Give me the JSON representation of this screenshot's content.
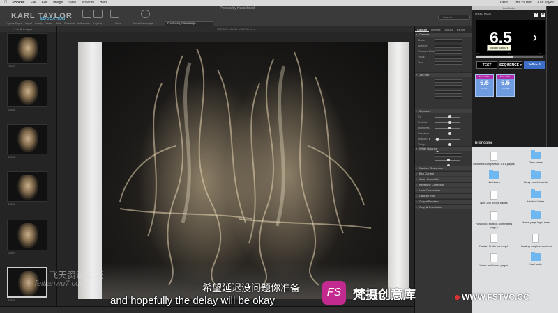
{
  "menubar": {
    "app": "Phocus",
    "items": [
      "File",
      "Edit",
      "Image",
      "View",
      "Window",
      "Help"
    ],
    "window_title": "Phocus by Hasselblad",
    "datetime": "Thu 15 Nov",
    "battery": "100%",
    "user": "Karl Taylor"
  },
  "toolbar": {
    "logo": "KARL TAYLOR",
    "logo_sub": "EDUCATION",
    "capture_style": "Capture (Standard)",
    "search_placeholder": "Search",
    "labels": [
      "Capture",
      "Export",
      "Import",
      "Quality",
      "Delete",
      "Print",
      "Slideshow",
      "Preferences",
      "Layouts",
      "Show",
      "Portrait/Landscape",
      "Adjustments"
    ]
  },
  "browser": {
    "header": "1 of 38 images",
    "thumbs": [
      "20003",
      "20021",
      "20022",
      "20023",
      "20024",
      "20025"
    ],
    "selected_index": 5
  },
  "viewer": {
    "info": "ISO 200  6.5s  f/8  1/800  50 mm"
  },
  "tool_panel": {
    "tabs": [
      "Capture",
      "Browse",
      "Adjust",
      "Export"
    ],
    "active_tab": "Capture",
    "sections": [
      "Camera",
      "Job Info",
      "Exposure",
      "White Balance",
      "Capture Sequencer",
      "Blur Control",
      "Color Correction",
      "Keystone Correction",
      "Lens Corrections",
      "Capture Info",
      "Output Preview",
      "Crop & Orientation"
    ],
    "camera_rows": [
      "Shutter",
      "Aperture",
      "Exposure Mode",
      "Focus",
      "Drive"
    ],
    "exposure_rows": [
      "EV",
      "Contrast",
      "Brightness",
      "Saturation",
      "Shadow Fill",
      "Clarity",
      "Haze"
    ]
  },
  "broncolor": {
    "window_title": "bronControl",
    "speed_mode": "SPEED MODE",
    "main_value": "6.5",
    "slider_fill": 0.55,
    "tick_labels": [
      "2.0",
      "6.5",
      "10"
    ],
    "test_label": "TEST",
    "sequence_label": "SEQUENCE ▾",
    "speed_label": "SPEED",
    "tooltip": "Trigger capture",
    "units": [
      {
        "name": "Siros 800 L",
        "value": "6.5",
        "label": "1/3700 s"
      },
      {
        "name": "Siros 800 L",
        "value": "6.5",
        "label": "1/3700 s"
      }
    ],
    "brand": "broncolor",
    "accent_color": "#3d6fc8"
  },
  "desktop": {
    "items": [
      {
        "label": "Modifiers comparison V1.1.pages",
        "type": "doc"
      },
      {
        "label": "Desk mess",
        "type": "folder"
      },
      {
        "label": "Nashicam",
        "type": "folder"
      },
      {
        "label": "Davy mood boards",
        "type": "folder"
      },
      {
        "label": "New Job books pages",
        "type": "doc"
      },
      {
        "label": "Hidden Water",
        "type": "folder"
      },
      {
        "label": "Parabolic, softbox, comments pages",
        "type": "doc"
      },
      {
        "label": "Home page login area",
        "type": "folder"
      },
      {
        "label": "Rachel Smith intro.mp4",
        "type": "doc"
      },
      {
        "label": "Housing weights.numbers",
        "type": "doc"
      },
      {
        "label": "Video and hours pages",
        "type": "doc"
      },
      {
        "label": "Karl to do",
        "type": "folder"
      }
    ]
  },
  "overlay": {
    "subtitle_cn": "希望延迟没问题你准备",
    "subtitle_en": "and hopefully the delay will be okay",
    "watermark_cn": "飞天资源论坛",
    "watermark_url": "feitianwu7.com",
    "brand_logo": "FS",
    "brand_name": "梵摄创意库",
    "site": "WWW.FSTVC.CC"
  }
}
